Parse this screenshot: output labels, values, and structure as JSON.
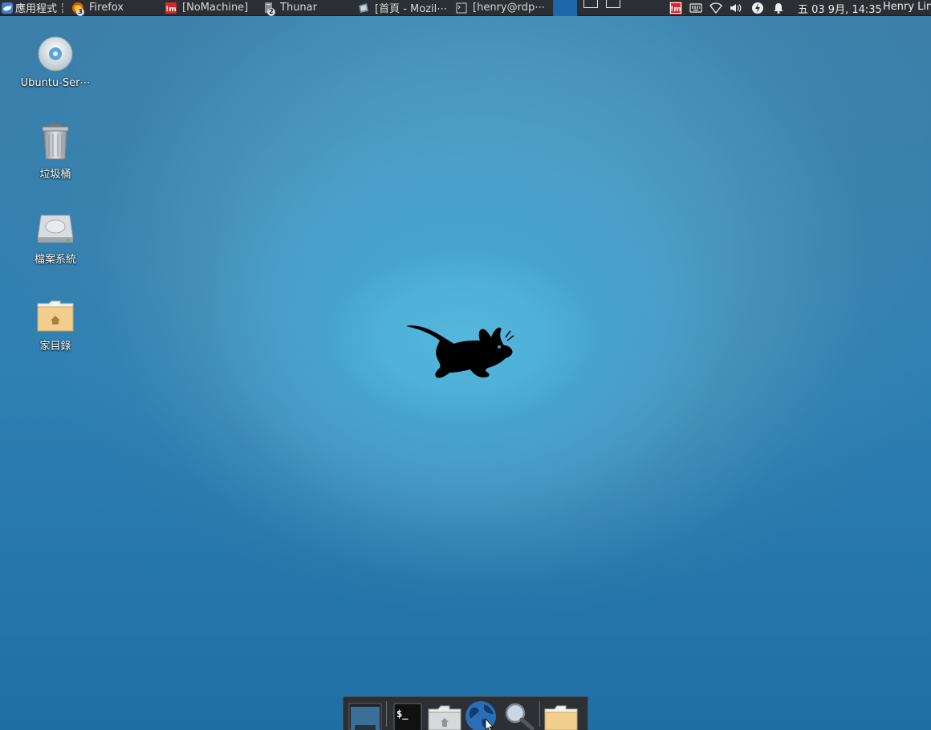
{
  "top_panel": {
    "apps_menu_label": "應用程式",
    "tasks": [
      {
        "label": "Firefox",
        "badge": "3",
        "icon": "firefox-icon"
      },
      {
        "label": "[NoMachine]",
        "icon": "nomachine-icon"
      },
      {
        "label": "Thunar",
        "badge": "2",
        "icon": "thunar-icon"
      },
      {
        "label": "[首頁 - Mozil⋯",
        "icon": "firefox-window-icon"
      },
      {
        "label": "[henry@rdp⋯",
        "icon": "terminal-icon"
      }
    ],
    "clock": "五 03 9月, 14:35",
    "user": "Henry Lin"
  },
  "desktop": {
    "icons": [
      {
        "label": "Ubuntu-Ser⋯",
        "icon": "cdrom-icon"
      },
      {
        "label": "垃圾桶",
        "icon": "trash-icon"
      },
      {
        "label": "檔案系統",
        "icon": "harddisk-icon"
      },
      {
        "label": "家目錄",
        "icon": "home-folder-icon"
      }
    ]
  },
  "dock": {
    "items": [
      {
        "name": "show-desktop",
        "icon": "desktop-icon"
      },
      {
        "name": "terminal",
        "icon": "terminal-icon",
        "text": "$_"
      },
      {
        "name": "file-manager",
        "icon": "home-folder-icon"
      },
      {
        "name": "web-browser",
        "icon": "globe-icon"
      },
      {
        "name": "app-finder",
        "icon": "magnifier-icon"
      },
      {
        "name": "folder",
        "icon": "folder-icon"
      }
    ]
  },
  "colors": {
    "panel_bg": "#2b2e32",
    "active_workspace": "#1e67a8",
    "wallpaper_center": "#55b7dc",
    "wallpaper_edge": "#1f6fa6",
    "nomachine_red": "#d8262b"
  }
}
